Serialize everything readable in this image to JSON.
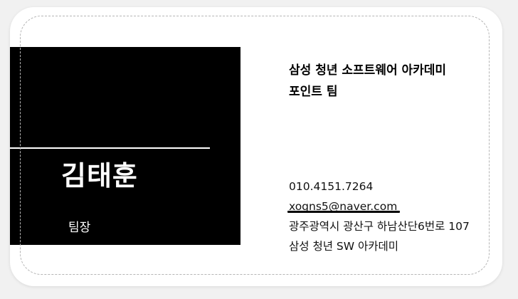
{
  "card": {
    "name": "김태훈",
    "role": "팀장",
    "organization_lines": [
      "삼성 청년 소프트웨어 아카데미",
      "포인트 팀"
    ],
    "phone": "010.4151.7264",
    "email": "xogns5@naver.com",
    "address": "광주광역시 광산구 하남산단6번로 107",
    "company": "삼성 청년 SW 아카데미"
  },
  "colors": {
    "panel": "#000000",
    "background": "#ffffff",
    "page": "#f1f1f1"
  }
}
